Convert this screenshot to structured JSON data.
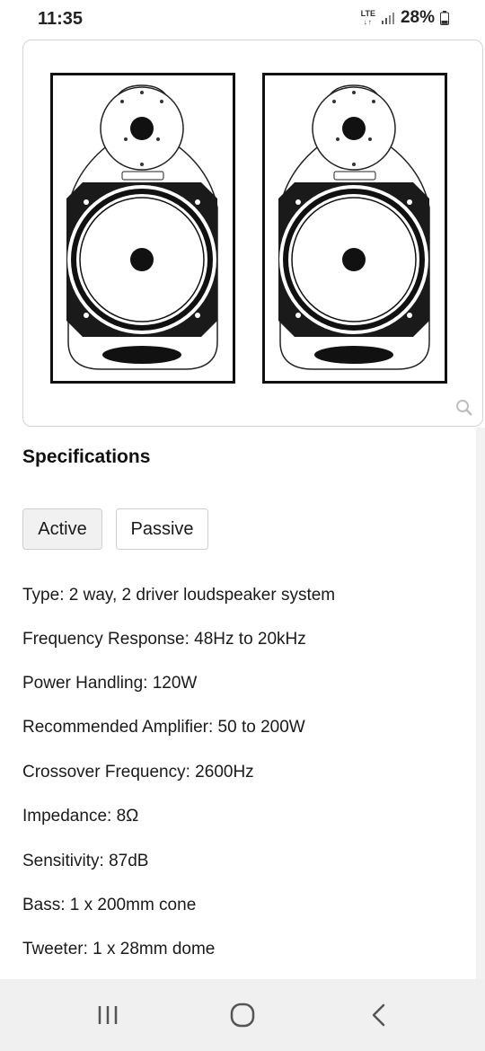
{
  "status_bar": {
    "time": "11:35",
    "network_label": "LTE",
    "battery": "28%"
  },
  "image_card": {
    "subject": "pair of bookshelf speakers line drawing",
    "icon": "zoom-icon"
  },
  "specs": {
    "title": "Specifications",
    "tabs": [
      {
        "label": "Active",
        "selected": true
      },
      {
        "label": "Passive",
        "selected": false
      }
    ],
    "lines": [
      "Type: 2 way, 2 driver loudspeaker system",
      "Frequency Response: 48Hz to 20kHz",
      "Power Handling: 120W",
      "Recommended Amplifier: 50 to 200W",
      "Crossover Frequency: 2600Hz",
      "Impedance: 8Ω",
      "Sensitivity: 87dB",
      "Bass: 1 x 200mm cone",
      "Tweeter: 1 x 28mm dome"
    ]
  },
  "nav_bar": {
    "icons": [
      "recent-apps-icon",
      "home-icon",
      "back-icon"
    ]
  }
}
